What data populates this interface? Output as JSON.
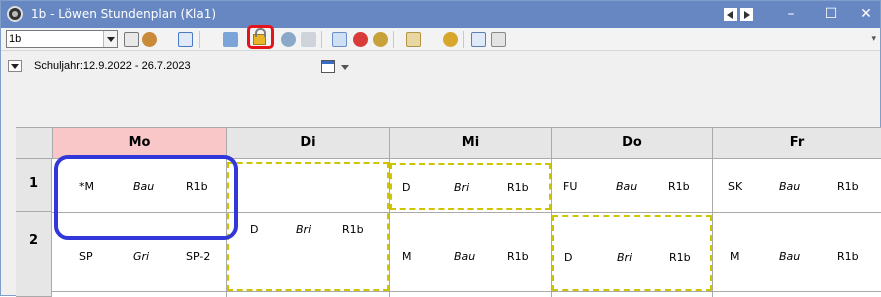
{
  "window": {
    "title": "1b - Löwen Stundenplan (Kla1)",
    "minimize_glyph": "–",
    "maximize_glyph": "☐",
    "close_glyph": "✕"
  },
  "toolbar": {
    "class_value": "1b",
    "icons": [
      "spinner-icon",
      "group-icon",
      "grid-icon",
      "transfer-icon",
      "lock-icon",
      "link-icon",
      "undo-icon",
      "pencil-icon",
      "search-icon",
      "users-icon",
      "document-icon",
      "gear-icon",
      "export-icon",
      "list-icon"
    ],
    "lock_highlight_color": "#e5141b"
  },
  "yearbar": {
    "school_year": "Schuljahr:12.9.2022 - 26.7.2023"
  },
  "grid": {
    "days": [
      "Mo",
      "Di",
      "Mi",
      "Do",
      "Fr"
    ],
    "periods": [
      "1",
      "2"
    ],
    "lessons": {
      "mo1": [
        "*M",
        "Bau",
        "R1b"
      ],
      "mo2": [
        "SP",
        "Gri",
        "SP-2"
      ],
      "di12": [
        "D",
        "Bri",
        "R1b"
      ],
      "mi1": [
        "D",
        "Bri",
        "R1b"
      ],
      "mi2": [
        "M",
        "Bau",
        "R1b"
      ],
      "do1": [
        "FU",
        "Bau",
        "R1b"
      ],
      "do2": [
        "D",
        "Bri",
        "R1b"
      ],
      "fr1": [
        "SK",
        "Bau",
        "R1b"
      ],
      "fr2": [
        "M",
        "Bau",
        "R1b"
      ]
    },
    "colors": {
      "monday_header": "#f9c7c7",
      "highlight_ring": "#3137d9",
      "dashed_yellow": "#cfc400",
      "dashed_blue": "#2b2fd1"
    }
  }
}
